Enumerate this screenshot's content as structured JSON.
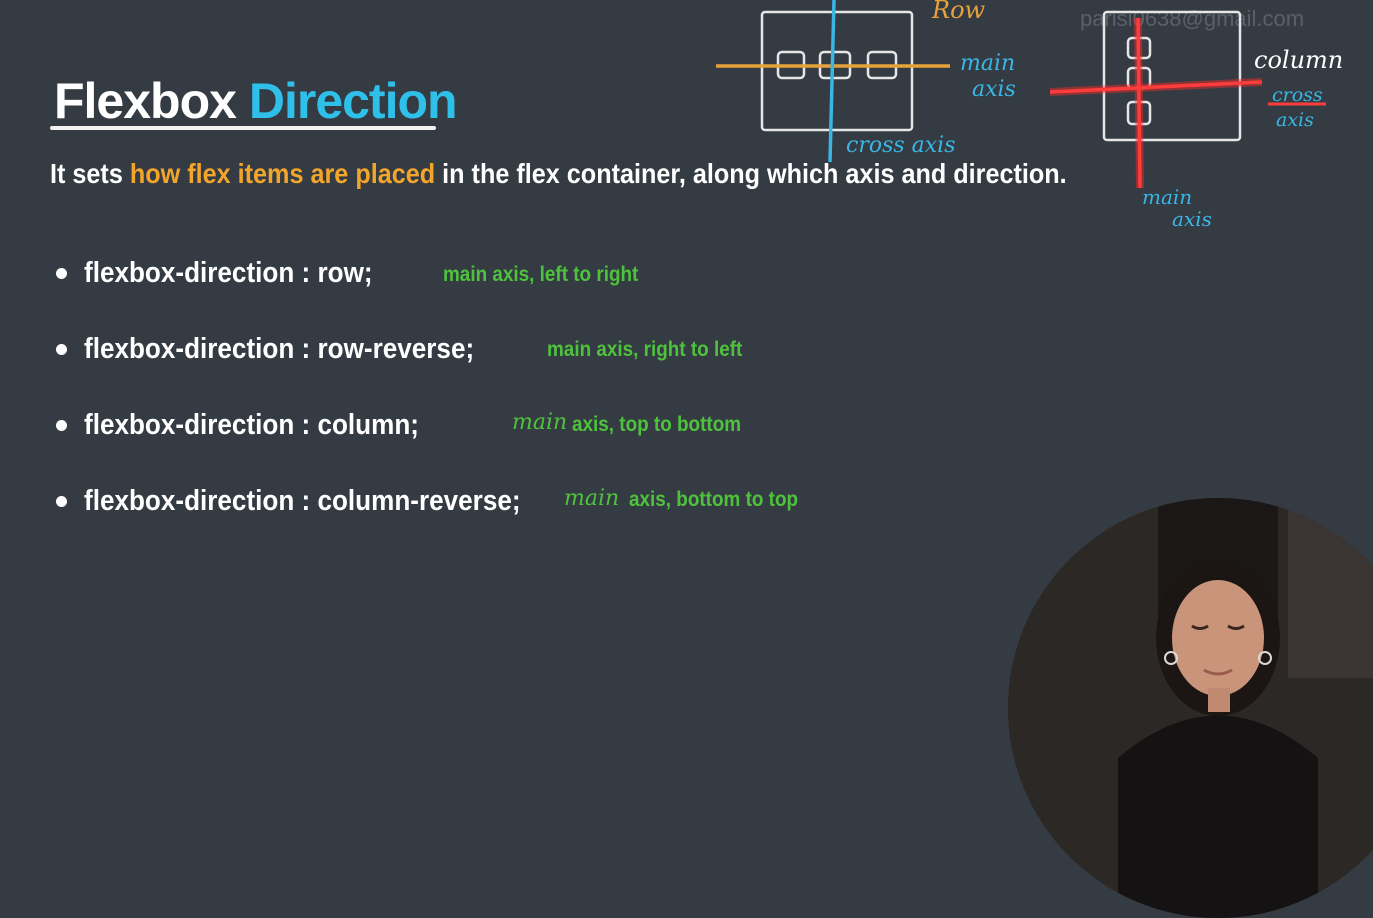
{
  "watermark": "parisi0638@gmail.com",
  "title": {
    "word1": "Flexbox",
    "word2": "Direction"
  },
  "subtitle": {
    "pre": "It sets ",
    "highlight": "how flex items are placed",
    "post": " in the flex container, along which axis and direction."
  },
  "items": [
    {
      "code": "flexbox-direction : row;",
      "note": "main axis, left to right",
      "handwritten_prefix": ""
    },
    {
      "code": "flexbox-direction : row-reverse;",
      "note": "main axis, right to left",
      "handwritten_prefix": ""
    },
    {
      "code": "flexbox-direction : column;",
      "note": "axis, top to bottom",
      "handwritten_prefix": "main"
    },
    {
      "code": "flexbox-direction : column-reverse;",
      "note": "axis, bottom to top",
      "handwritten_prefix": "main"
    }
  ],
  "annotations": {
    "row_label": "Row",
    "row_main_axis": [
      "main",
      "axis"
    ],
    "row_cross_axis": "cross axis",
    "column_label": "column",
    "column_cross_axis": [
      "cross",
      "axis"
    ],
    "column_main_axis": [
      "main",
      "axis"
    ]
  },
  "colors": {
    "background": "#353b43",
    "title_accent": "#2fc0ea",
    "highlight": "#f2a52b",
    "note_green": "#4ec23d",
    "annotation_blue": "#39b6e3",
    "annotation_orange": "#e7a33b",
    "annotation_red": "#ff2a2a"
  },
  "webcam": {
    "description_icon": "presenter-video-icon"
  }
}
